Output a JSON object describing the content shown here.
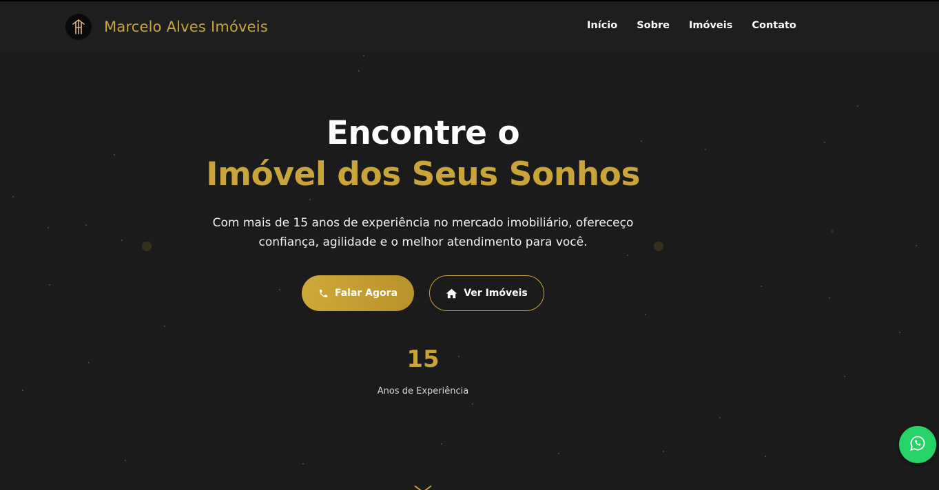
{
  "header": {
    "brand": "Marcelo Alves Imóveis",
    "nav": [
      "Início",
      "Sobre",
      "Imóveis",
      "Contato"
    ]
  },
  "hero": {
    "title_line1": "Encontre o",
    "title_line2": "Imóvel dos Seus Sonhos",
    "subtitle_line1": "Com mais de 15 anos de experiência no mercado imobiliário, ofereceço",
    "subtitle_line2": "confiança, agilidade e o melhor atendimento para você.",
    "primary_button": "Falar Agora",
    "secondary_button": "Ver Imóveis",
    "stat_number": "15",
    "stat_label": "Anos de Experiência"
  },
  "icons": {
    "logo": "logo-mark-icon",
    "primary_button": "phone-icon",
    "secondary_button": "home-icon",
    "scroll": "chevron-down-icon",
    "floating": "whatsapp-icon"
  },
  "colors": {
    "background": "#1b1b1c",
    "accent_gold": "#c9a43a",
    "whatsapp_green": "#25d366"
  }
}
